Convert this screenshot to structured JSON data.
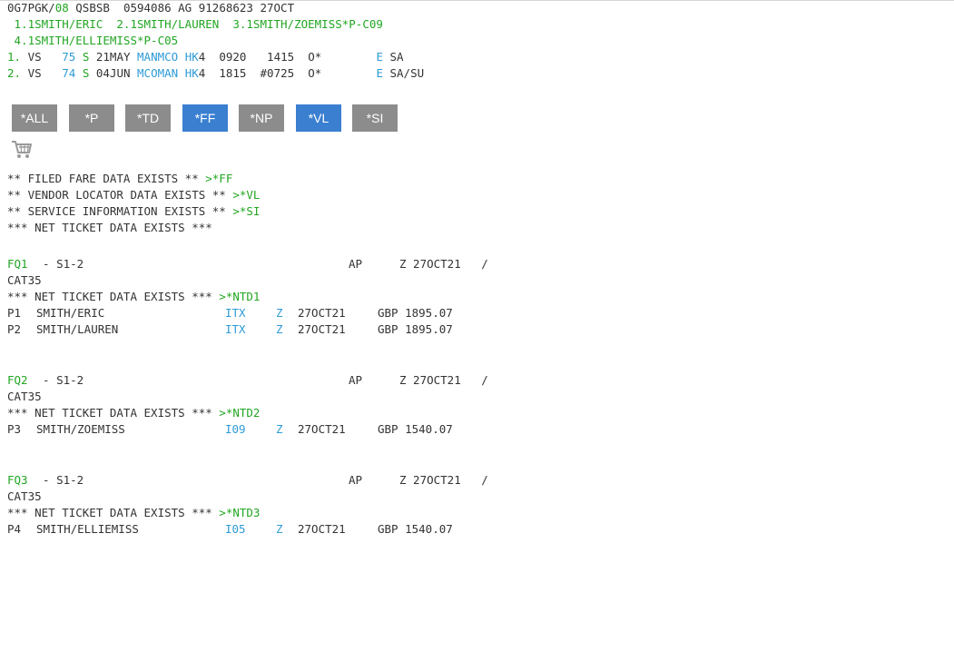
{
  "pnr": {
    "header": {
      "record": "0G7PGK/",
      "seg": "08",
      "rest": " QSBSB  0594086 AG 91268623 27OCT"
    },
    "names_line1": " 1.1SMITH/ERIC  2.1SMITH/LAUREN  3.1SMITH/ZOEMISS*P-C09",
    "names_line2": " 4.1SMITH/ELLIEMISS*P-C05",
    "segments": [
      {
        "num": "1.",
        "airline": " VS   ",
        "flight": "75",
        "cls": "S",
        "date": " 21MAY ",
        "city": "MANMCO",
        "status": "HK",
        "rest": "4  0920   1415  O*        ",
        "e": "E",
        "tail": " SA"
      },
      {
        "num": "2.",
        "airline": " VS   ",
        "flight": "74",
        "cls": "S",
        "date": " 04JUN ",
        "city": "MCOMAN",
        "status": "HK",
        "rest": "4  1815  #0725  O*        ",
        "e": "E",
        "tail": " SA/SU"
      }
    ]
  },
  "buttons": [
    "*ALL",
    "*P",
    "*TD",
    "*FF",
    "*NP",
    "*VL",
    "*SI"
  ],
  "colors": {
    "green": "#22a622",
    "blue": "#2f9bd6",
    "button_gray": "#8c8c8c",
    "button_blue": "#3a7fd0"
  },
  "icons": {
    "cart": "shopping-cart-icon"
  },
  "notices": [
    {
      "text": "** FILED FARE DATA EXISTS ** ",
      "cmd": ">*FF"
    },
    {
      "text": "** VENDOR LOCATOR DATA EXISTS ** ",
      "cmd": ">*VL"
    },
    {
      "text": "** SERVICE INFORMATION EXISTS ** ",
      "cmd": ">*SI"
    },
    {
      "text": "*** NET TICKET DATA EXISTS ***",
      "cmd": ""
    }
  ],
  "fares": [
    {
      "label": "FQ1",
      "seg": "  - S1-2",
      "ap": "AP",
      "date": "Z 27OCT21   /",
      "cat": "CAT35",
      "net_text": "*** NET TICKET DATA EXISTS *** ",
      "net_cmd": ">*NTD1",
      "pax": [
        {
          "id": "P1",
          "name": "SMITH/ERIC",
          "type": "ITX",
          "z": "Z",
          "date": "27OCT21",
          "amount": "GBP 1895.07"
        },
        {
          "id": "P2",
          "name": "SMITH/LAUREN",
          "type": "ITX",
          "z": "Z",
          "date": "27OCT21",
          "amount": "GBP 1895.07"
        }
      ]
    },
    {
      "label": "FQ2",
      "seg": "  - S1-2",
      "ap": "AP",
      "date": "Z 27OCT21   /",
      "cat": "CAT35",
      "net_text": "*** NET TICKET DATA EXISTS *** ",
      "net_cmd": ">*NTD2",
      "pax": [
        {
          "id": "P3",
          "name": "SMITH/ZOEMISS",
          "type": "I09",
          "z": "Z",
          "date": "27OCT21",
          "amount": "GBP 1540.07"
        }
      ]
    },
    {
      "label": "FQ3",
      "seg": "  - S1-2",
      "ap": "AP",
      "date": "Z 27OCT21   /",
      "cat": "CAT35",
      "net_text": "*** NET TICKET DATA EXISTS *** ",
      "net_cmd": ">*NTD3",
      "pax": [
        {
          "id": "P4",
          "name": "SMITH/ELLIEMISS",
          "type": "I05",
          "z": "Z",
          "date": "27OCT21",
          "amount": "GBP 1540.07"
        }
      ]
    }
  ]
}
